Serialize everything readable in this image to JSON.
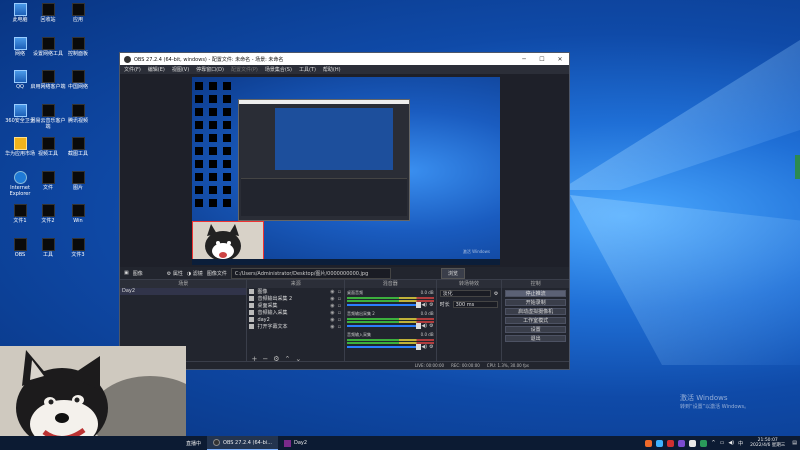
{
  "desktop_icons": [
    {
      "label": "此电脑",
      "type": "app"
    },
    {
      "label": "回收站",
      "type": "black"
    },
    {
      "label": "应用",
      "type": "black"
    },
    {
      "label": "网络",
      "type": "app"
    },
    {
      "label": "设置网络工具",
      "type": "black"
    },
    {
      "label": "控制面板",
      "type": "black"
    },
    {
      "label": "QQ",
      "type": "app"
    },
    {
      "label": "启用网络客户端",
      "type": "black"
    },
    {
      "label": "中国网络",
      "type": "black"
    },
    {
      "label": "360安全卫士",
      "type": "app"
    },
    {
      "label": "网易云音乐客户端",
      "type": "black"
    },
    {
      "label": "腾讯视频",
      "type": "black"
    },
    {
      "label": "华为应用市场",
      "type": "yel"
    },
    {
      "label": "视频工具",
      "type": "black"
    },
    {
      "label": "截图工具",
      "type": "black"
    },
    {
      "label": "Internet Explorer",
      "type": "ie"
    },
    {
      "label": "文件",
      "type": "black"
    },
    {
      "label": "图片",
      "type": "black"
    },
    {
      "label": "文件1",
      "type": "black"
    },
    {
      "label": "文件2",
      "type": "black"
    },
    {
      "label": "Win",
      "type": "black"
    },
    {
      "label": "OBS",
      "type": "black"
    },
    {
      "label": "工具",
      "type": "black"
    },
    {
      "label": "文件3",
      "type": "black"
    }
  ],
  "obs": {
    "title": "OBS 27.2.4 (64-bit, windows) - 配置文件: 未命名 - 场景: 未命名",
    "menu": [
      "文件(F)",
      "编辑(E)",
      "视图(V)",
      "停靠窗口(D)",
      "配置文件(P)",
      "场景集合(S)",
      "工具(T)",
      "帮助(H)"
    ],
    "status_row": {
      "source_label": "图像",
      "properties_label": "属性",
      "filters_label": "滤镜",
      "file_label": "图像文件",
      "path": "C:/Users/Administrator/Desktop/图片/0000000000.jpg",
      "browse_label": "浏览"
    },
    "docks": {
      "scenes_header": "场景",
      "scenes": [
        "Day2"
      ],
      "sources_header": "来源",
      "sources": [
        {
          "label": "图像",
          "icon": "image-icon"
        },
        {
          "label": "音频输出采集 2",
          "icon": "speaker-icon"
        },
        {
          "label": "桌面采集",
          "icon": "monitor-icon"
        },
        {
          "label": "音频输入采集",
          "icon": "mic-icon"
        },
        {
          "label": "day2",
          "icon": "camera-icon"
        },
        {
          "label": "打开字幕文本",
          "icon": "text-icon"
        }
      ],
      "mixer_header": "混音器",
      "mixer": [
        {
          "name": "桌面音频",
          "db": "0.0 dB"
        },
        {
          "name": "音频输出采集 2",
          "db": "0.0 dB"
        },
        {
          "name": "音频输入采集",
          "db": "0.0 dB"
        }
      ],
      "transitions_header": "转场特效",
      "transition_type": "淡化",
      "duration_label": "时长",
      "duration_value": "300 ms",
      "controls_header": "控制",
      "controls": [
        "停止推流",
        "开始录制",
        "启动虚拟摄像机",
        "工作室模式",
        "设置",
        "退出"
      ]
    },
    "statusbar": {
      "live_label": "LIVE: 00:00:00",
      "rec_label": "REC: 00:00:00",
      "cpu_label": "CPU: 1.3%, 30.00 fps"
    }
  },
  "taskbar": {
    "items": [
      {
        "label": "直播中",
        "active": false
      },
      {
        "label": "OBS 27.2.4 (64-bi...",
        "active": true
      },
      {
        "label": "Day2",
        "active": false
      }
    ],
    "time": "21:50:07",
    "date": "2022/4/6 星期三"
  },
  "activation": {
    "title": "激活 Windows",
    "subtitle": "转到“设置”以激活 Windows。"
  },
  "colors": {
    "obs_bg": "#2b2e38",
    "dock_bg": "#22252e",
    "accent_meter": "#3fbf3f",
    "taskbar_bg": "#0c1b33"
  }
}
